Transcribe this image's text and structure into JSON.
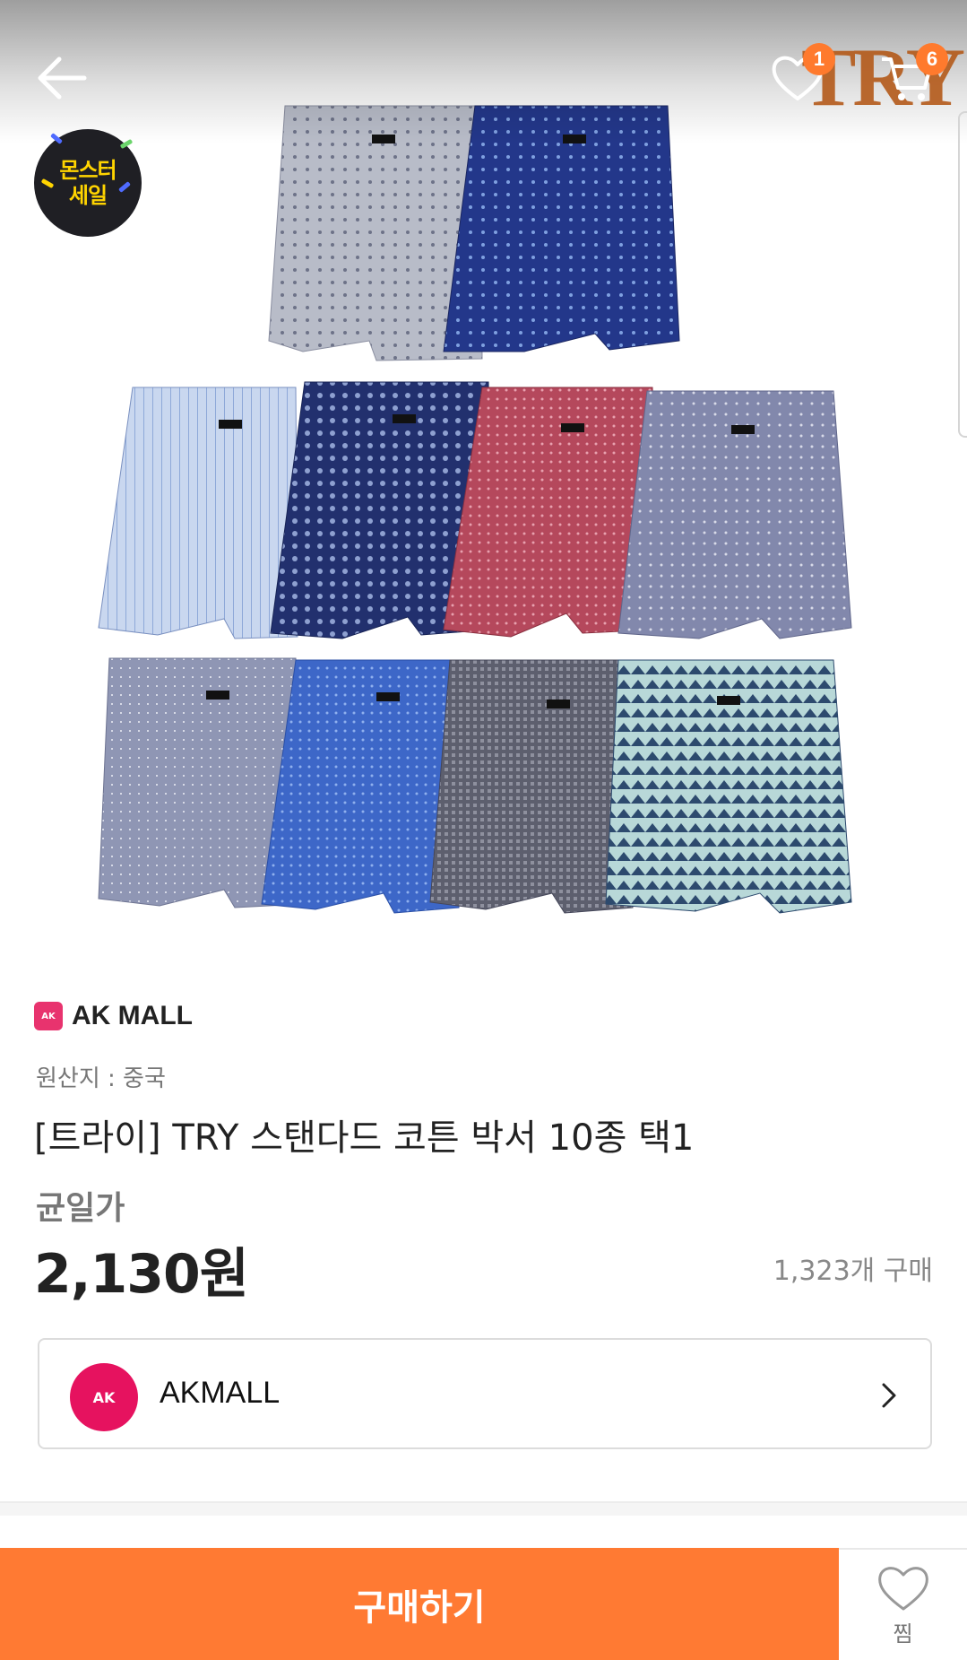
{
  "header": {
    "wishlist_count": "1",
    "cart_count": "6",
    "brand_watermark": "TRY"
  },
  "promo": {
    "line1": "몬스터",
    "line2": "세일"
  },
  "product": {
    "seller_brand": "AK MALL",
    "seller_mark": "AK",
    "origin": "원산지 : 중국",
    "title": "[트라이] TRY 스탠다드 코튼 박서 10종 택1",
    "price_label": "균일가",
    "price": "2,130원",
    "purchase_count": "1,323개 구매"
  },
  "store": {
    "name": "AKMALL",
    "logo_text": "AK"
  },
  "bottom_bar": {
    "buy_label": "구매하기",
    "wish_label": "찜"
  },
  "icons": {
    "back": "arrow-left-icon",
    "wishlist": "heart-icon",
    "cart": "cart-icon",
    "chevron": "chevron-right-icon"
  },
  "colors": {
    "accent": "#ff7a33",
    "badge": "#ff7a2d",
    "store_logo": "#e6125f"
  }
}
